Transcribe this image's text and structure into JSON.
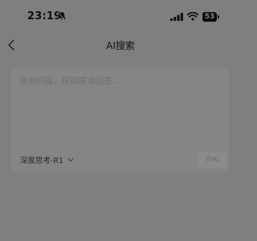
{
  "status_bar": {
    "time": "23:19",
    "battery_level": "53",
    "icons": [
      "bell-muted-icon",
      "signal-icon",
      "wifi-icon",
      "battery-icon"
    ]
  },
  "header": {
    "title": "AI搜索",
    "back_icon": "chevron-left-icon"
  },
  "search": {
    "placeholder": "提出问题，获取精准回答...",
    "value": ""
  },
  "model_selector": {
    "selected": "深度思考-R1",
    "icon": "chevron-down-icon"
  },
  "submit": {
    "label": "问AI"
  },
  "colors": {
    "background": "#7f7f7f",
    "card": "#858585",
    "text_dark": "#111111",
    "placeholder": "#6e6e6e"
  }
}
